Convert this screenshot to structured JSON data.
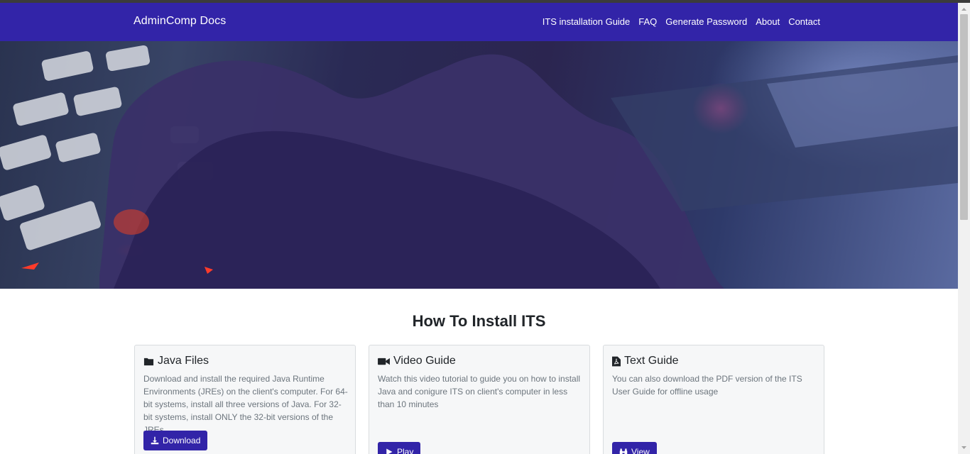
{
  "navbar": {
    "brand": "AdminComp Docs",
    "links": [
      "ITS installation Guide",
      "FAQ",
      "Generate Password",
      "About",
      "Contact"
    ]
  },
  "hero": {
    "image": "hand-on-keyboard-photo"
  },
  "section": {
    "title": "How To Install ITS"
  },
  "cards": [
    {
      "icon": "folder-icon",
      "title": "Java Files",
      "text": "Download and install the required Java Runtime Environments (JREs) on the client's computer. For 64-bit systems, install all three versions of Java. For 32-bit systems, install ONLY the 32-bit versions of the JREs",
      "button": "Download",
      "button_icon": "download-icon"
    },
    {
      "icon": "video-icon",
      "title": "Video Guide",
      "text": "Watch this video tutorial to guide you on how to install Java and conigure ITS on client's computer in less than 10 minutes",
      "button": "Play",
      "button_icon": "play-icon"
    },
    {
      "icon": "pdf-file-icon",
      "title": "Text Guide",
      "text": "You can also download the PDF version of the ITS User Guide for offline usage",
      "button": "View",
      "button_icon": "binoculars-icon"
    }
  ],
  "colors": {
    "primary": "#3224a8",
    "card_bg": "#f6f7f8",
    "muted_text": "#6c757d"
  }
}
